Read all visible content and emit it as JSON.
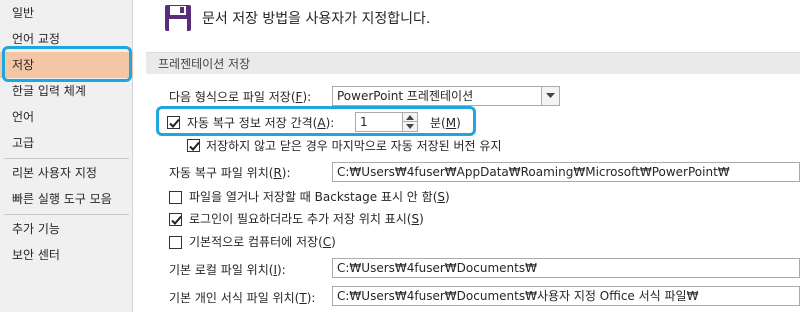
{
  "sidebar": {
    "items": [
      {
        "label": "일반"
      },
      {
        "label": "언어 교정"
      },
      {
        "label": "저장"
      },
      {
        "label": "한글 입력 체계"
      },
      {
        "label": "언어"
      },
      {
        "label": "고급"
      },
      {
        "label": "리본 사용자 지정"
      },
      {
        "label": "빠른 실행 도구 모음"
      },
      {
        "label": "추가 기능"
      },
      {
        "label": "보안 센터"
      }
    ],
    "selected": "저장"
  },
  "header": {
    "text": "문서 저장 방법을 사용자가 지정합니다.",
    "icon": "floppy-disk-icon"
  },
  "section": {
    "title": "프레젠테이션 저장"
  },
  "save_format": {
    "label": "다음 형식으로 파일 저장(",
    "accel": "F",
    "suffix": "):",
    "value": "PowerPoint 프레젠테이션"
  },
  "autorecover": {
    "checked": true,
    "label": "자동 복구 정보 저장 간격(",
    "accel": "A",
    "suffix": "):",
    "value": "1",
    "unit_label": "분(",
    "unit_accel": "M",
    "unit_suffix": ")"
  },
  "keep_last": {
    "checked": true,
    "label": "저장하지 않고 닫은 경우 마지막으로 자동 저장된 버전 유지"
  },
  "autorecover_location": {
    "label": "자동 복구 파일 위치(",
    "accel": "R",
    "suffix": "):",
    "value": "C:₩Users₩4fuser₩AppData₩Roaming₩Microsoft₩PowerPoint₩"
  },
  "backstage": {
    "checked": false,
    "label": "파일을 열거나 저장할 때 Backstage 표시 안 함(",
    "accel": "S",
    "suffix": ")"
  },
  "additional_locations": {
    "checked": true,
    "label": "로그인이 필요하더라도 추가 저장 위치 표시(",
    "accel": "S",
    "suffix": ")"
  },
  "save_to_computer": {
    "checked": false,
    "label": "기본적으로 컴퓨터에 저장(",
    "accel": "C",
    "suffix": ")"
  },
  "default_local": {
    "label": "기본 로컬 파일 위치(",
    "accel": "I",
    "suffix": "):",
    "value": "C:₩Users₩4fuser₩Documents₩"
  },
  "default_template": {
    "label": "기본 개인 서식 파일 위치(",
    "accel": "T",
    "suffix": "):",
    "value": "C:₩Users₩4fuser₩Documents₩사용자 지정 Office 서식 파일₩"
  },
  "colors": {
    "highlight": "#1ea6de",
    "selected_bg": "#f5c6a5"
  }
}
